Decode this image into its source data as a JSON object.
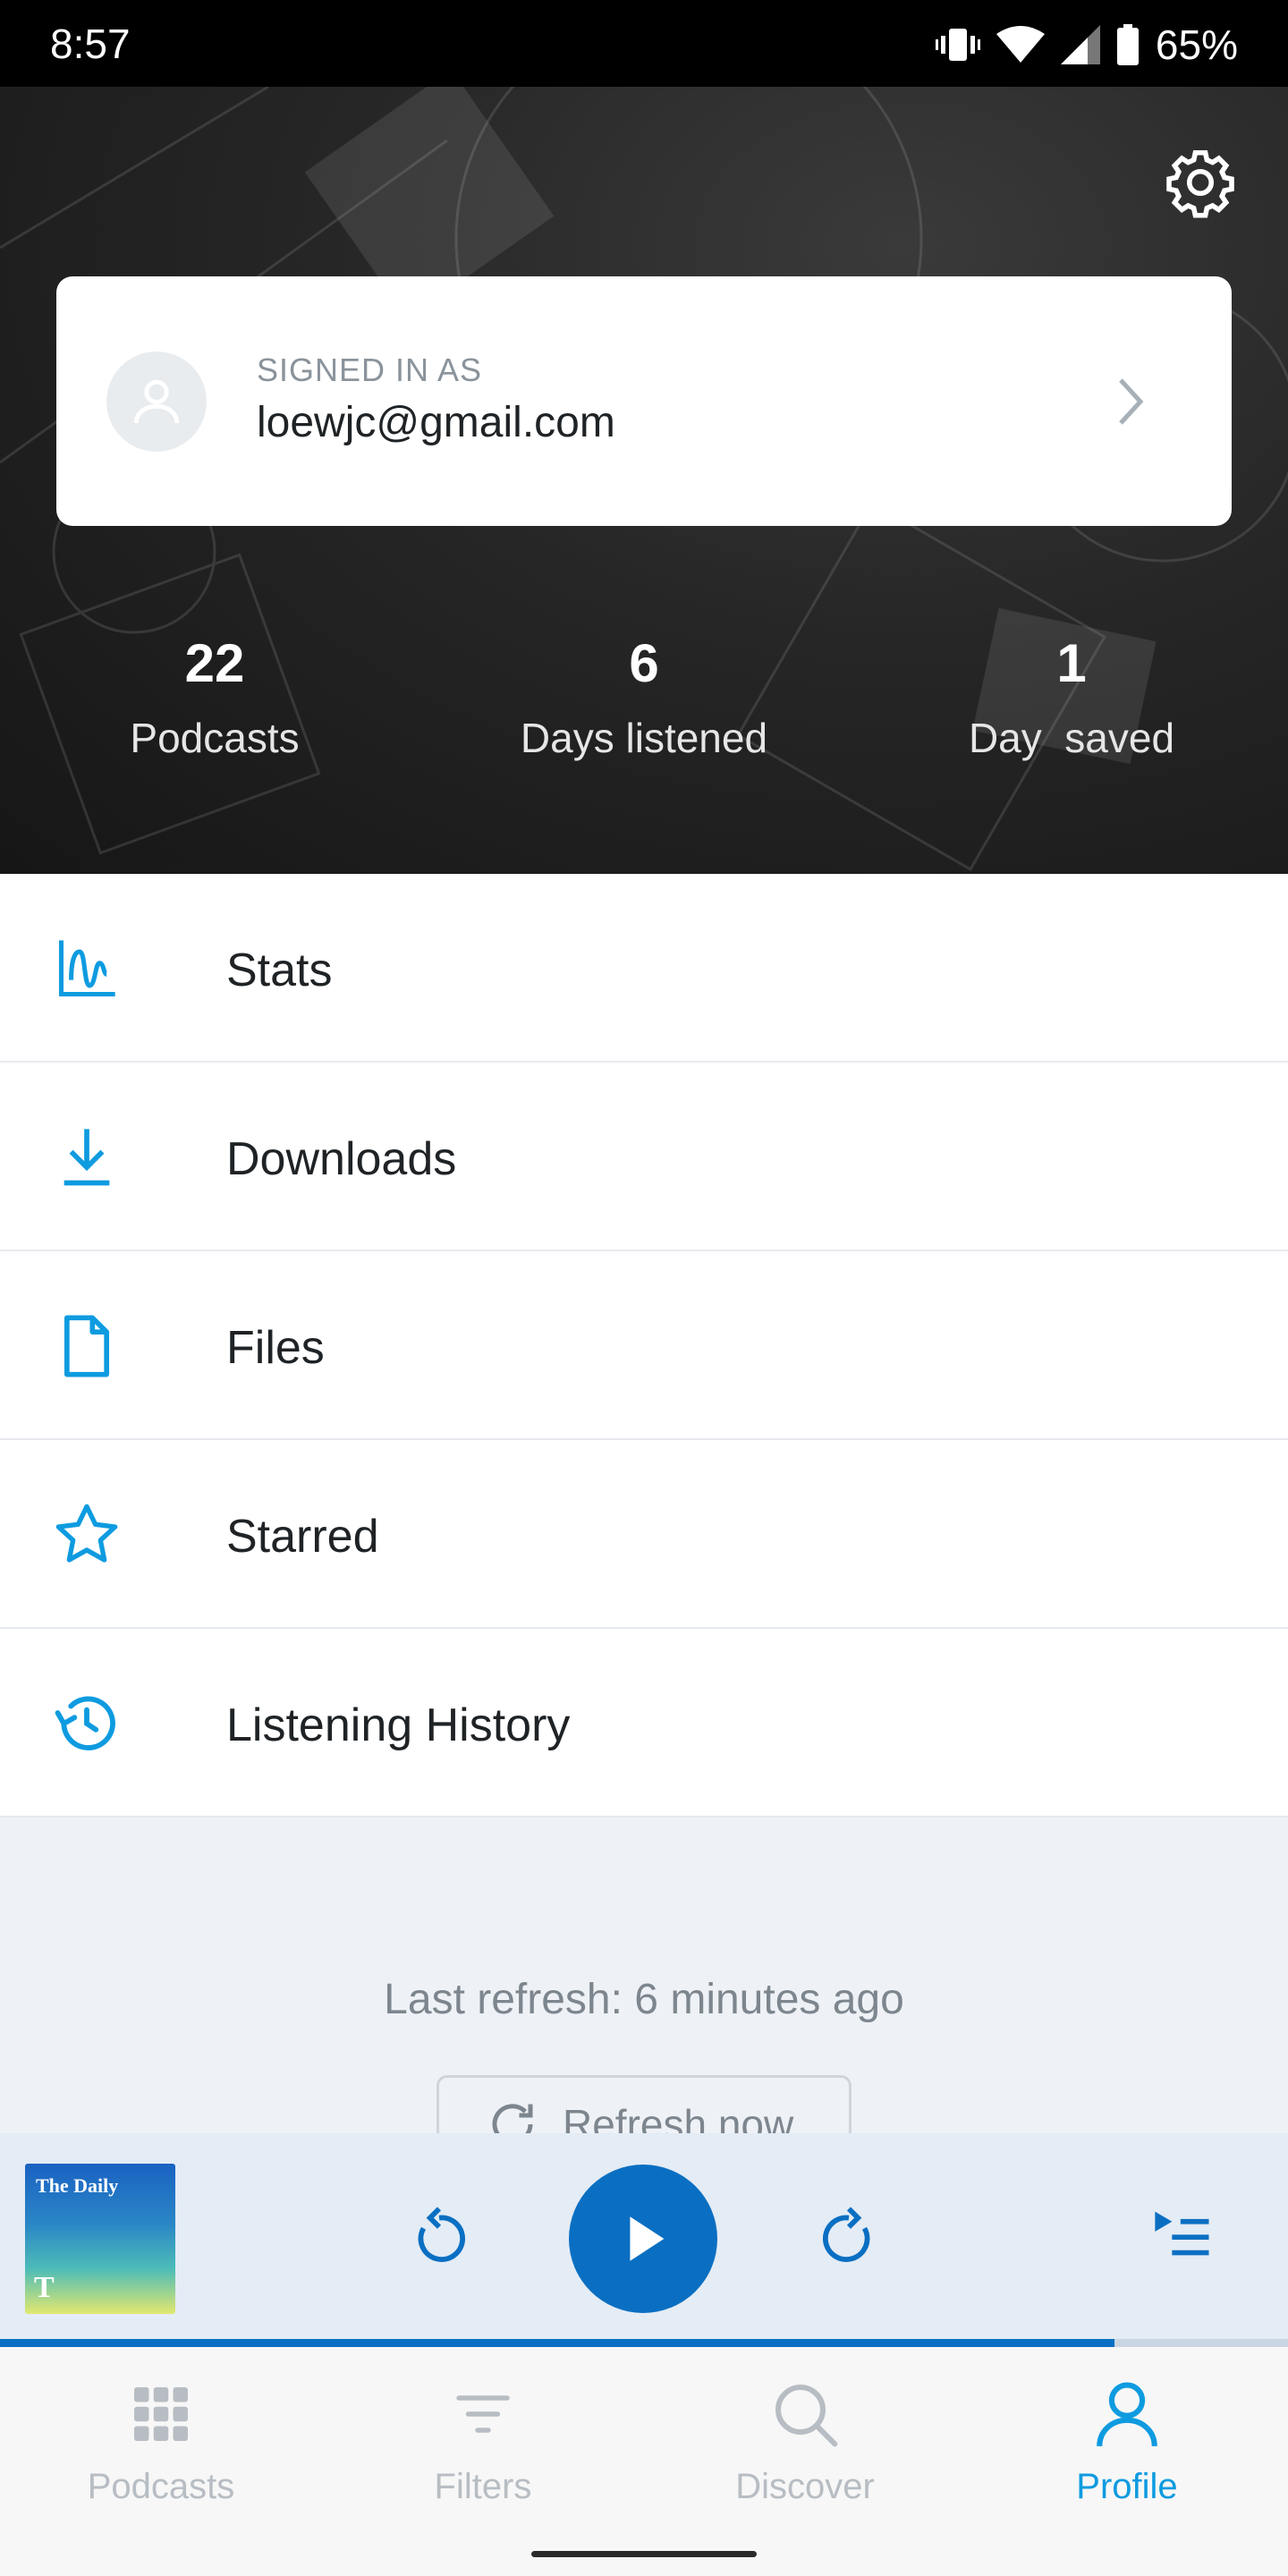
{
  "status_bar": {
    "time": "8:57",
    "battery": "65%"
  },
  "header": {
    "signed_in_label": "SIGNED IN AS",
    "email": "loewjc@gmail.com",
    "stats": [
      {
        "value": "22",
        "label": "Podcasts"
      },
      {
        "value": "6",
        "label": "Days listened"
      },
      {
        "value": "1",
        "label": "Day  saved"
      }
    ]
  },
  "menu": [
    {
      "label": "Stats",
      "icon": "stats-icon"
    },
    {
      "label": "Downloads",
      "icon": "download-icon"
    },
    {
      "label": "Files",
      "icon": "file-icon"
    },
    {
      "label": "Starred",
      "icon": "star-icon"
    },
    {
      "label": "Listening History",
      "icon": "history-icon"
    }
  ],
  "refresh": {
    "last_refresh": "Last refresh: 6 minutes ago",
    "button_label": "Refresh now"
  },
  "player": {
    "cover_title": "The Daily",
    "cover_logo": "T",
    "progress": 0.865
  },
  "bottom_nav": [
    {
      "label": "Podcasts",
      "active": false
    },
    {
      "label": "Filters",
      "active": false
    },
    {
      "label": "Discover",
      "active": false
    },
    {
      "label": "Profile",
      "active": true
    }
  ],
  "colors": {
    "accent": "#0e9be0",
    "play_button": "#0a6fc2",
    "inactive_nav": "#b7bdc3"
  }
}
